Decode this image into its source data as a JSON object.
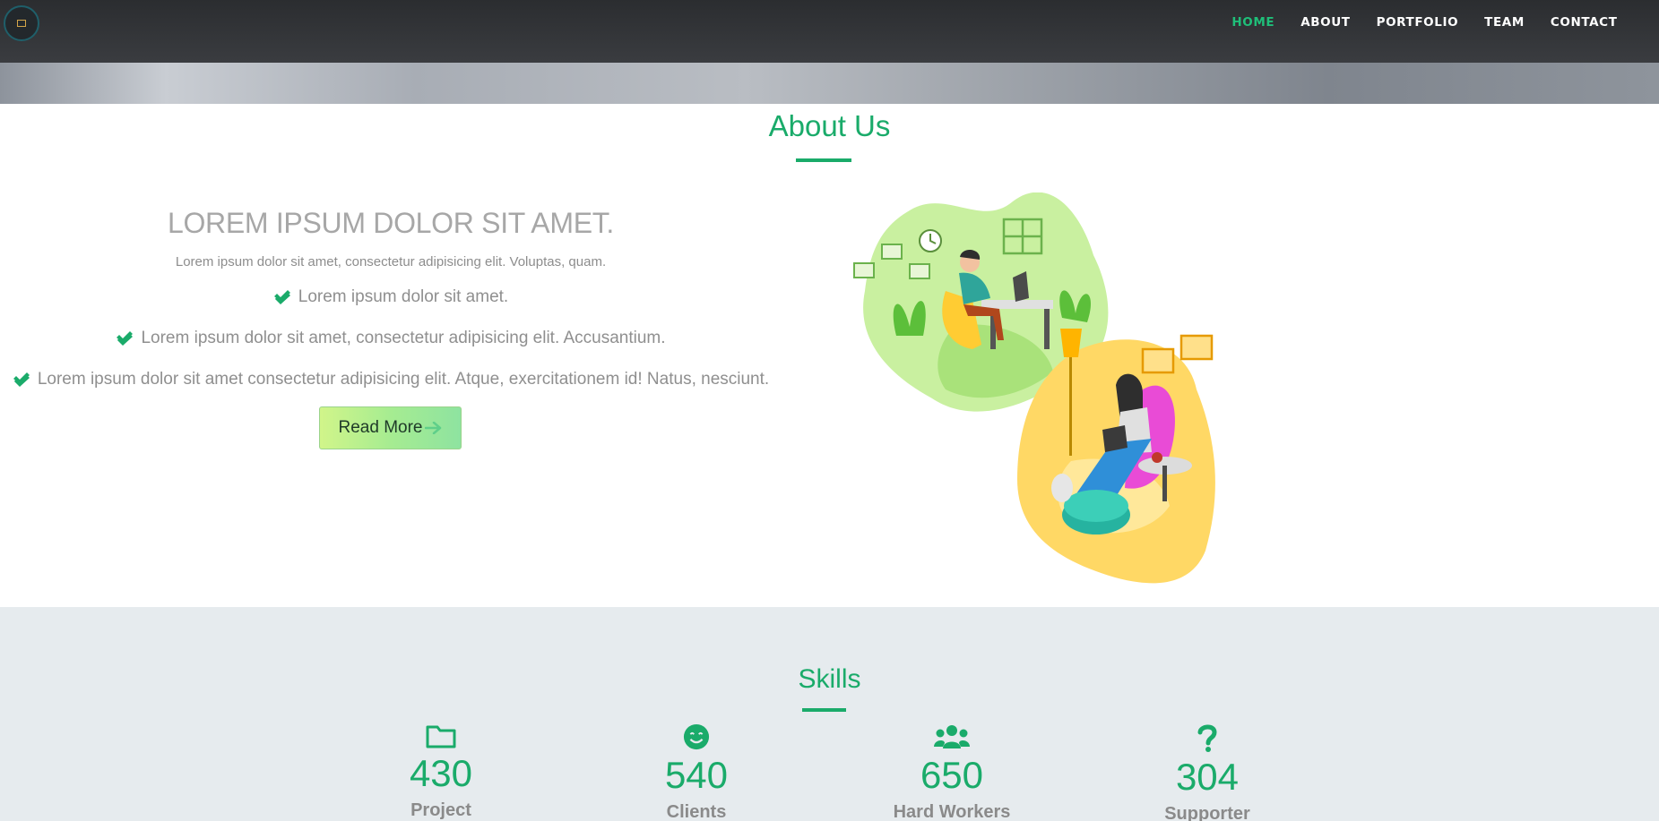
{
  "nav": {
    "items": [
      {
        "label": "HOME",
        "active": true
      },
      {
        "label": "ABOUT"
      },
      {
        "label": "PORTFOLIO"
      },
      {
        "label": "TEAM"
      },
      {
        "label": "CONTACT"
      }
    ],
    "active_color": "#1fbf79"
  },
  "about": {
    "title": "About Us",
    "heading": "LOREM IPSUM DOLOR SIT AMET.",
    "subtitle": "Lorem ipsum dolor sit amet, consectetur adipisicing elit. Voluptas, quam.",
    "points": [
      "Lorem ipsum dolor sit amet.",
      "Lorem ipsum dolor sit amet, consectetur adipisicing elit. Accusantium.",
      "Lorem ipsum dolor sit amet consectetur adipisicing elit. Atque, exercitationem id! Natus, nesciunt."
    ],
    "read_more": "Read More"
  },
  "skills": {
    "title": "Skills",
    "stats": [
      {
        "value": "430",
        "label": "Project",
        "icon": "folder-icon"
      },
      {
        "value": "540",
        "label": "Clients",
        "icon": "smile-icon"
      },
      {
        "value": "650",
        "label": "Hard Workers",
        "icon": "users-icon"
      },
      {
        "value": "304",
        "label": "Supporter",
        "icon": "question-icon"
      }
    ]
  },
  "colors": {
    "accent": "#1aab6a",
    "navbar": "#2b2d30",
    "skills_bg": "#e6ebee"
  }
}
